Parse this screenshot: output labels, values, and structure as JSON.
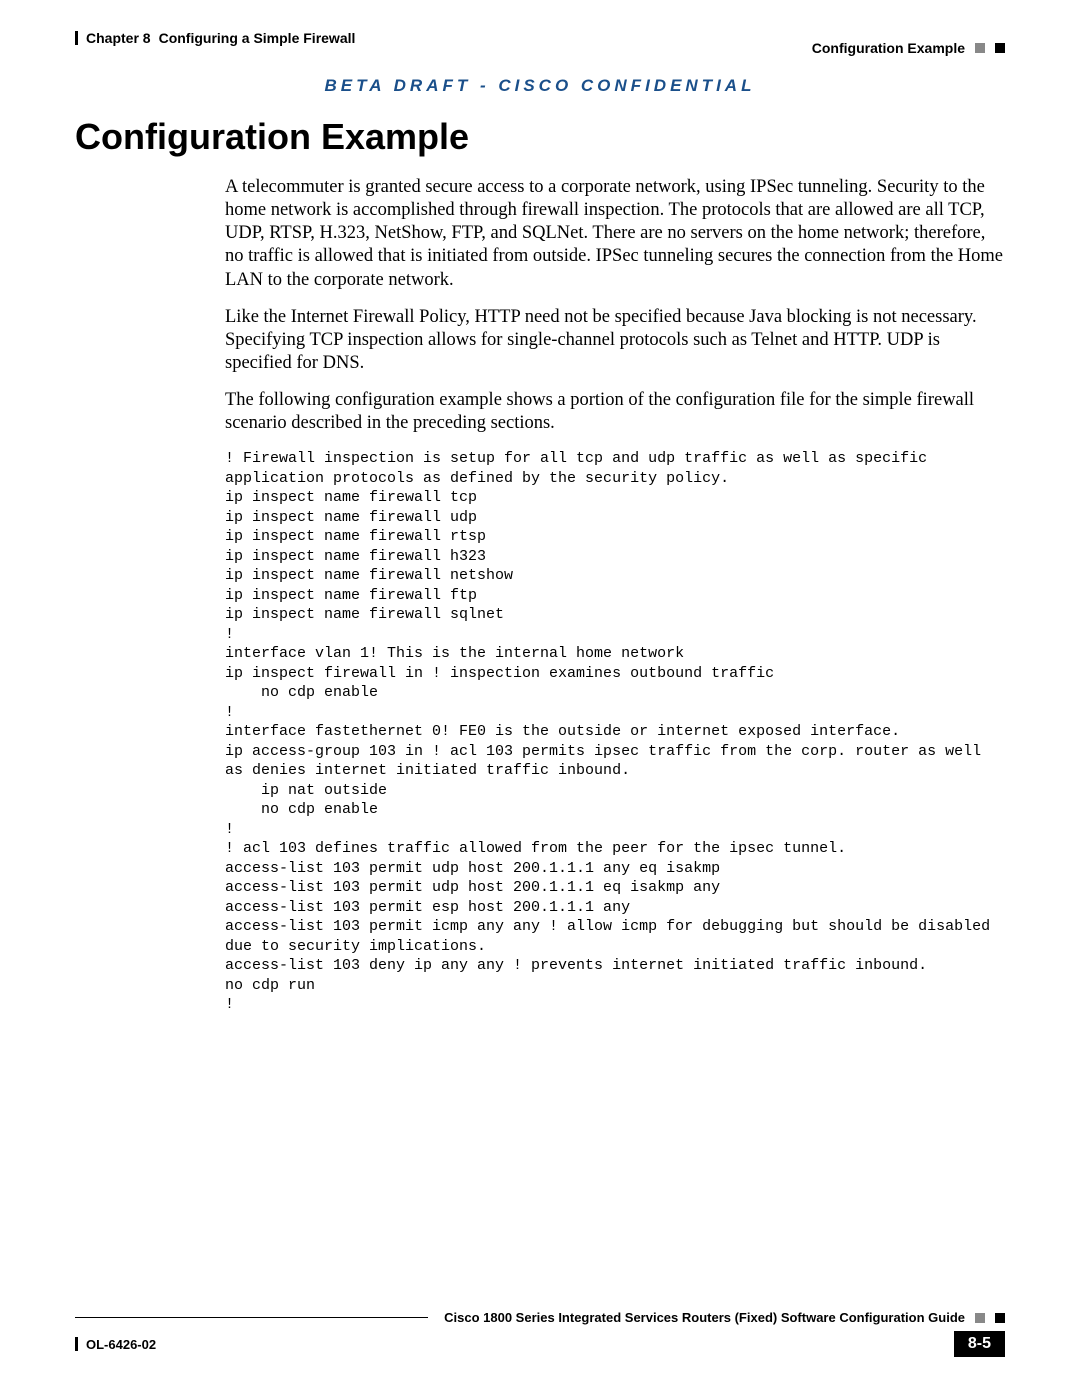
{
  "header": {
    "chapter_label": "Chapter 8",
    "chapter_title": "Configuring a Simple Firewall",
    "section": "Configuration Example"
  },
  "draft_notice": "BETA DRAFT - CISCO CONFIDENTIAL",
  "title": "Configuration Example",
  "paragraphs": {
    "p1": "A telecommuter is granted secure access to a corporate network, using IPSec tunneling. Security to the home network is accomplished through firewall inspection. The protocols that are allowed are all TCP, UDP, RTSP, H.323, NetShow, FTP, and SQLNet. There are no servers on the home network; therefore, no traffic is allowed that is initiated from outside. IPSec tunneling secures the connection from the Home LAN to the corporate network.",
    "p2": "Like the Internet Firewall Policy, HTTP need not be specified because Java blocking is not necessary. Specifying TCP inspection allows for single-channel protocols such as Telnet and HTTP. UDP is specified for DNS.",
    "p3": "The following configuration example shows a portion of the configuration file for the simple firewall scenario described in the preceding sections."
  },
  "code": "! Firewall inspection is setup for all tcp and udp traffic as well as specific application protocols as defined by the security policy.\nip inspect name firewall tcp\nip inspect name firewall udp\nip inspect name firewall rtsp\nip inspect name firewall h323\nip inspect name firewall netshow\nip inspect name firewall ftp\nip inspect name firewall sqlnet\n!\ninterface vlan 1! This is the internal home network\nip inspect firewall in ! inspection examines outbound traffic\n    no cdp enable\n!\ninterface fastethernet 0! FE0 is the outside or internet exposed interface.\nip access-group 103 in ! acl 103 permits ipsec traffic from the corp. router as well as denies internet initiated traffic inbound.\n    ip nat outside\n    no cdp enable\n!\n! acl 103 defines traffic allowed from the peer for the ipsec tunnel.\naccess-list 103 permit udp host 200.1.1.1 any eq isakmp\naccess-list 103 permit udp host 200.1.1.1 eq isakmp any\naccess-list 103 permit esp host 200.1.1.1 any\naccess-list 103 permit icmp any any ! allow icmp for debugging but should be disabled due to security implications.\naccess-list 103 deny ip any any ! prevents internet initiated traffic inbound.\nno cdp run\n!",
  "footer": {
    "guide": "Cisco 1800 Series Integrated Services Routers (Fixed) Software Configuration Guide",
    "doc_id": "OL-6426-02",
    "page": "8-5"
  }
}
